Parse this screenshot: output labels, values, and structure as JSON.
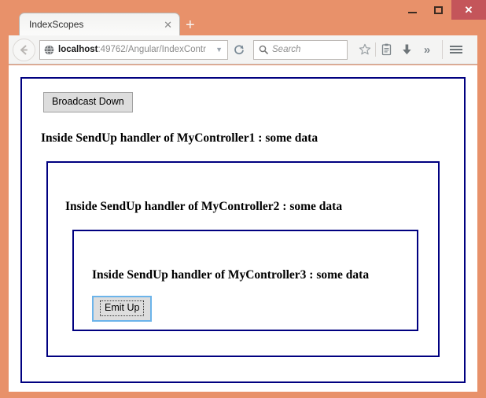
{
  "browser": {
    "window_controls": {
      "minimize_label": "−",
      "maximize_label": "□",
      "close_label": "✕",
      "close_color": "#c4555a"
    },
    "tab": {
      "title": "IndexScopes",
      "close_label": "✕",
      "new_tab_label": "+"
    },
    "navbar": {
      "back_icon": "back-arrow-icon",
      "site_icon": "globe-icon",
      "url_host": "localhost",
      "url_path": ":49762/Angular/IndexContr",
      "url_dropdown_label": "▼",
      "reload_icon": "reload-icon",
      "search_placeholder": "Search",
      "search_value": "",
      "search_icon": "magnifier-icon",
      "bookmark_icon": "star-icon",
      "reader_icon": "reading-list-icon",
      "download_icon": "download-arrow-icon",
      "overflow_label": "»",
      "menu_icon": "hamburger-menu-icon"
    },
    "chrome_color": "#e8916a"
  },
  "page": {
    "border_color": "#000080",
    "controllers": [
      {
        "name": "MyController1",
        "message": "Inside SendUp handler of MyController1 : some data",
        "button_label": "Broadcast Down"
      },
      {
        "name": "MyController2",
        "message": "Inside SendUp handler of MyController2 : some data"
      },
      {
        "name": "MyController3",
        "message": "Inside SendUp handler of MyController3 : some data",
        "button_label": "Emit Up",
        "button_focused": true
      }
    ]
  }
}
